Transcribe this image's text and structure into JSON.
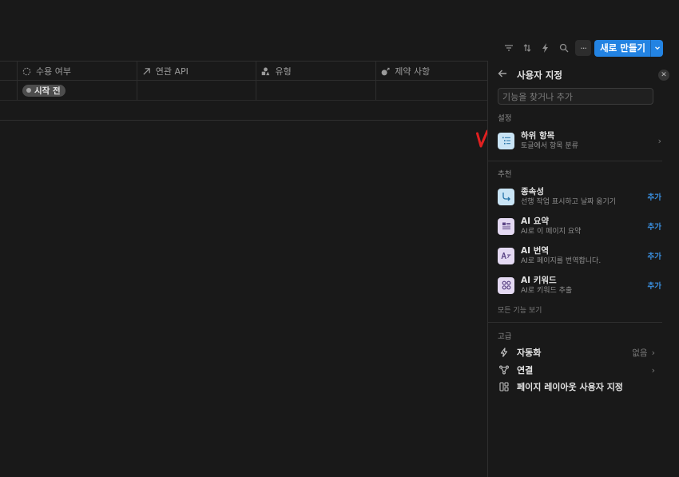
{
  "toolbar": {
    "icons": [
      "filter-icon",
      "sort-icon",
      "lightning-icon",
      "search-icon",
      "more-icon"
    ],
    "more_label": "···",
    "new_button_label": "새로 만들기"
  },
  "table": {
    "columns": [
      {
        "icon": "status-icon",
        "label": "수용 여부"
      },
      {
        "icon": "arrow-up-right-icon",
        "label": "연관 API"
      },
      {
        "icon": "shapes-icon",
        "label": "유형"
      },
      {
        "icon": "relation-icon",
        "label": "제약 사항"
      }
    ],
    "rows": [
      {
        "status": "시작 전"
      }
    ]
  },
  "panel": {
    "title": "사용자 지정",
    "search_placeholder": "기능을 찾거나 추가",
    "settings_label": "설정",
    "settings_items": [
      {
        "icon": "sub-items-icon",
        "title": "하위 항목",
        "desc": "토글에서 항목 분류"
      }
    ],
    "recommend_label": "추천",
    "recommend_items": [
      {
        "icon": "dependency-icon",
        "title": "종속성",
        "desc": "선행 작업 표시하고 날짜 옮기기",
        "action": "추가"
      },
      {
        "icon": "ai-summary-icon",
        "title": "AI 요약",
        "desc": "AI로 이 페이지 요약",
        "action": "추가"
      },
      {
        "icon": "ai-translate-icon",
        "title": "AI 번역",
        "desc": "AI로 페이지를 번역합니다.",
        "action": "추가"
      },
      {
        "icon": "ai-keywords-icon",
        "title": "AI 키워드",
        "desc": "AI로 키워드 추출",
        "action": "추가"
      }
    ],
    "see_all_label": "모든 기능 보기",
    "advanced_label": "고급",
    "advanced_items": [
      {
        "icon": "lightning-icon",
        "label": "자동화",
        "value": "없음"
      },
      {
        "icon": "connection-icon",
        "label": "연결",
        "value": ""
      },
      {
        "icon": "layout-icon",
        "label": "페이지 레이아웃 사용자 지정",
        "value": ""
      }
    ]
  },
  "colors": {
    "background": "#191919",
    "accent": "#2383e2",
    "annotation": "#e02020"
  }
}
